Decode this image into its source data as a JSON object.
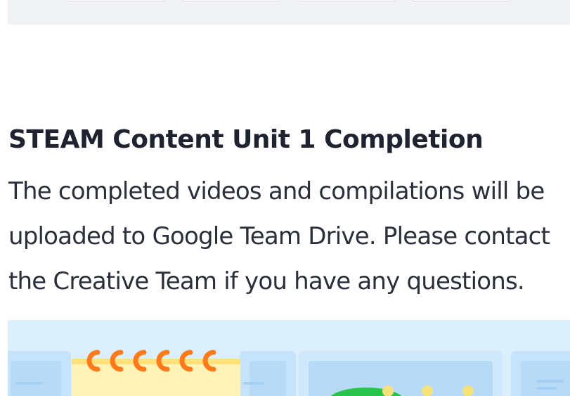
{
  "section": {
    "title": "STEAM Content Unit 1 Completion",
    "body_lines": [
      "The completed videos and compilations will be",
      "uploaded to Google Team Drive. Please contact",
      "the Creative Team if you have any questions."
    ]
  },
  "banner": {
    "icons": [
      "notepad-icon",
      "spiral-rings-icon",
      "green-blob-icon"
    ]
  },
  "colors": {
    "band": "#f1f2f4",
    "banner_bg": "#dceffd",
    "ring_orange": "#ff7a1a",
    "notepad_yellow": "#fff3b8",
    "blob_green": "#29c24a"
  }
}
